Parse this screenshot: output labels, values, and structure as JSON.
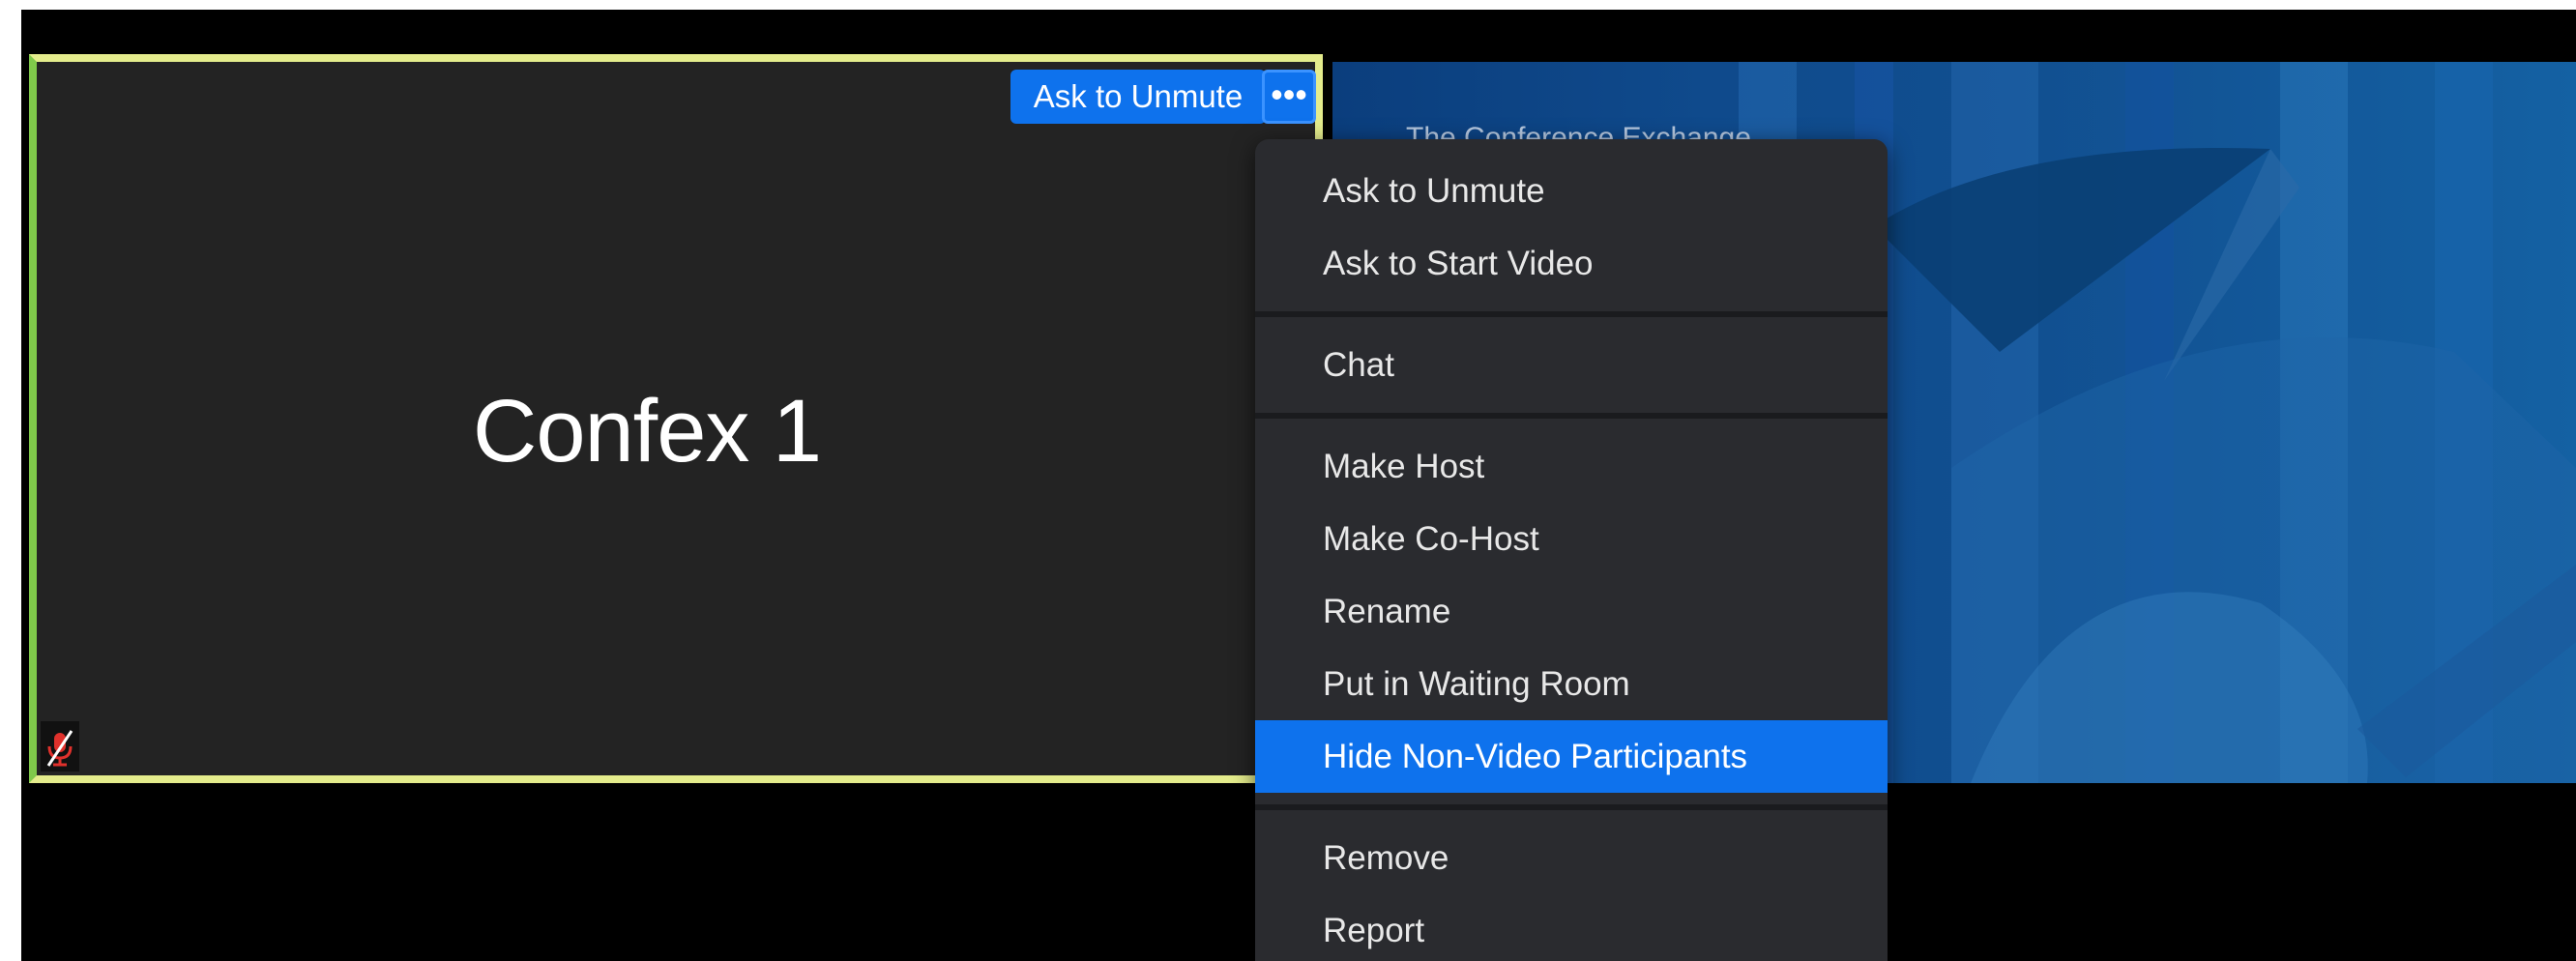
{
  "tile": {
    "participant_name": "Confex 1",
    "ask_unmute_label": "Ask to Unmute",
    "more_label": "•••"
  },
  "share": {
    "title": "The Conference Exchange"
  },
  "menu": {
    "items": [
      {
        "label": "Ask to Unmute"
      },
      {
        "label": "Ask to Start Video"
      },
      {
        "label": "Chat"
      },
      {
        "label": "Make Host"
      },
      {
        "label": "Make Co-Host"
      },
      {
        "label": "Rename"
      },
      {
        "label": "Put in Waiting Room"
      },
      {
        "label": "Hide Non-Video Participants"
      },
      {
        "label": "Remove"
      },
      {
        "label": "Report"
      }
    ],
    "highlighted": "Hide Non-Video Participants"
  },
  "colors": {
    "accent": "#0e72ed",
    "tile_border": "#e4ec8c",
    "menu_bg": "#2a2b2f",
    "mute_icon": "#e0312c"
  },
  "icons": {
    "muted_mic": "muted-microphone-icon",
    "more": "ellipsis-icon"
  }
}
